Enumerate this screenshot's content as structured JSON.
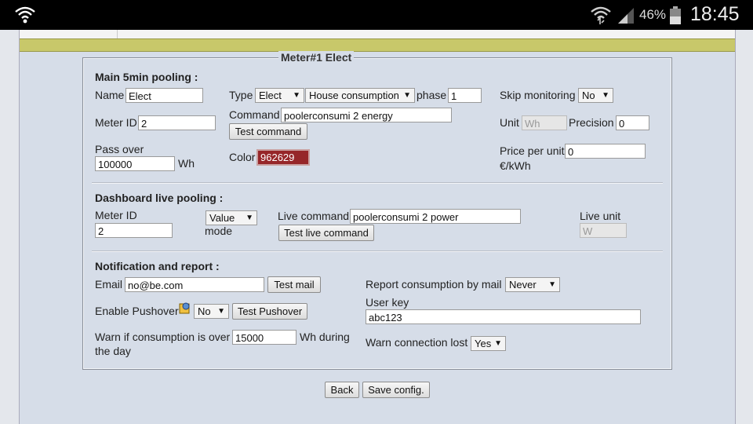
{
  "statusbar": {
    "battery_pct": "46%",
    "clock": "18:45"
  },
  "form": {
    "legend": "Meter#1 Elect",
    "main": {
      "heading": "Main 5min pooling :",
      "name_label": "Name",
      "name_value": "Elect",
      "type_label": "Type",
      "type_value": "Elect",
      "subtype_value": "House consumption",
      "phase_label": "phase",
      "phase_value": "1",
      "skip_label": "Skip monitoring",
      "skip_value": "No",
      "meterid_label": "Meter ID",
      "meterid_value": "2",
      "command_label": "Command",
      "command_value": "poolerconsumi 2 energy",
      "test_command": "Test command",
      "unit_label": "Unit",
      "unit_value": "Wh",
      "precision_label": "Precision",
      "precision_value": "0",
      "passover_label": "Pass over",
      "passover_value": "100000",
      "passover_unit": "Wh",
      "color_label": "Color",
      "color_value": "962629",
      "price_label": "Price per unit",
      "price_value": "0",
      "price_unit": "€/kWh"
    },
    "live": {
      "heading": "Dashboard live pooling :",
      "meterid_label": "Meter ID",
      "meterid_value": "2",
      "mode_value": "Value",
      "mode_label": "mode",
      "command_label": "Live command",
      "command_value": "poolerconsumi 2 power",
      "test_button": "Test live command",
      "unit_label": "Live unit",
      "unit_value": "W"
    },
    "notify": {
      "heading": "Notification and report :",
      "email_label": "Email",
      "email_value": "no@be.com",
      "test_mail": "Test mail",
      "report_label": "Report consumption by mail",
      "report_value": "Never",
      "pushover_label": "Enable Pushover",
      "pushover_value": "No",
      "test_pushover": "Test Pushover",
      "userkey_label": "User key",
      "userkey_value": "abc123",
      "warn_label": "Warn if consumption is over",
      "warn_value": "15000",
      "warn_suffix": "Wh during",
      "warn_suffix2": "the day",
      "warn_conn_label": "Warn connection lost",
      "warn_conn_value": "Yes"
    },
    "back_button": "Back",
    "save_button": "Save config."
  }
}
